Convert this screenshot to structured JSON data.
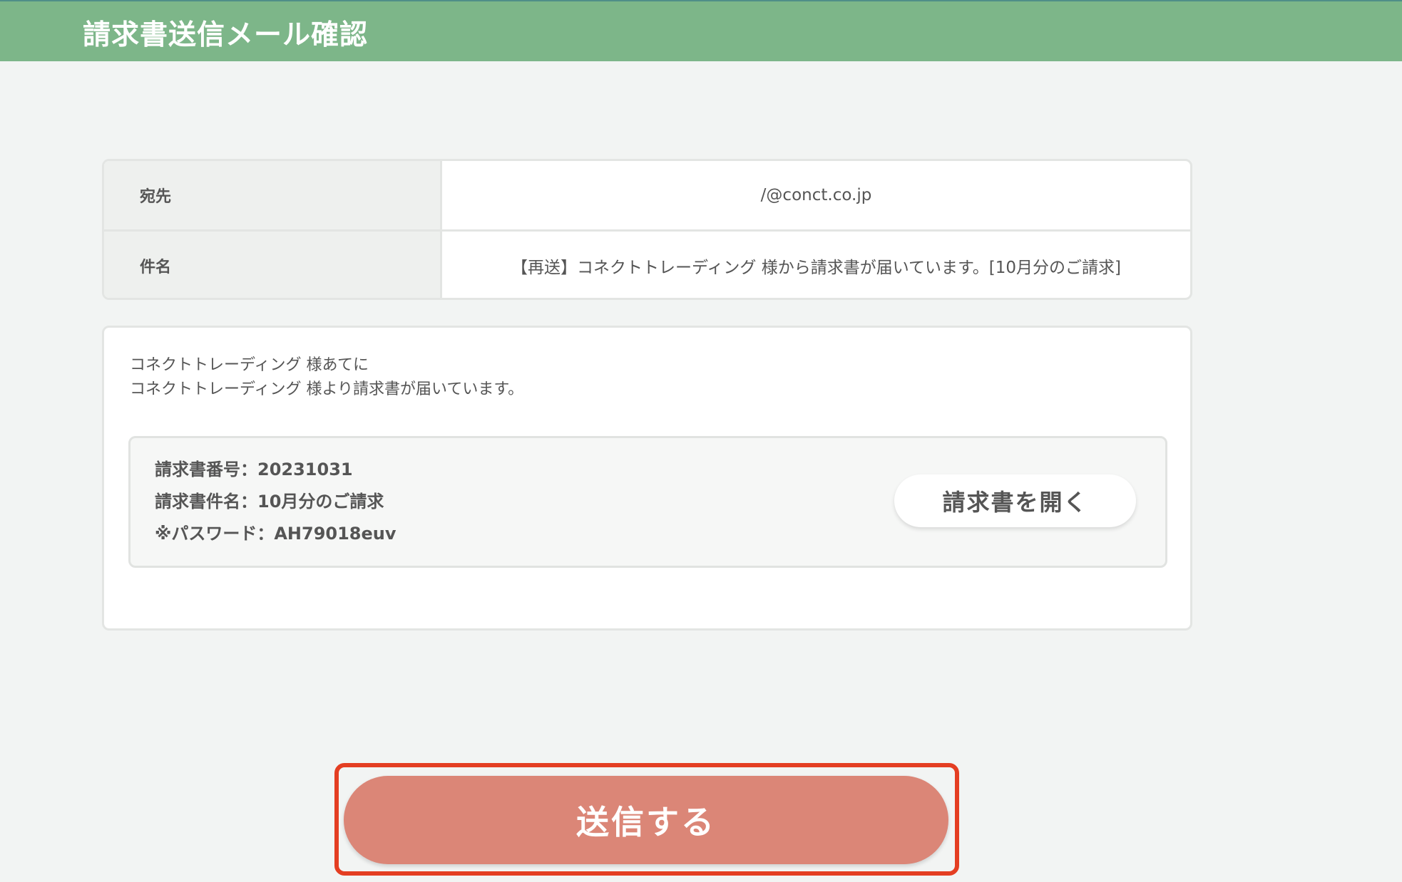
{
  "header": {
    "title": "請求書送信メール確認"
  },
  "details": {
    "to_label": "宛先",
    "to_value": "/@conct.co.jp",
    "subject_label": "件名",
    "subject_value": "【再送】コネクトトレーディング 様から請求書が届いています。[10月分のご請求]"
  },
  "message": {
    "line1": "コネクトトレーディング 様あてに",
    "line2": "コネクトトレーディング 様より請求書が届いています。"
  },
  "invoice": {
    "number_line": "請求書番号：20231031",
    "name_line": "請求書件名：10月分のご請求",
    "password_line": "※パスワード：AH79018euv",
    "open_button_label": "請求書を開く"
  },
  "actions": {
    "send_label": "送信する"
  },
  "colors": {
    "header_bg": "#7db689",
    "send_button_bg": "#db8677",
    "highlight_border": "#e43e22",
    "page_bg": "#f2f4f3"
  }
}
